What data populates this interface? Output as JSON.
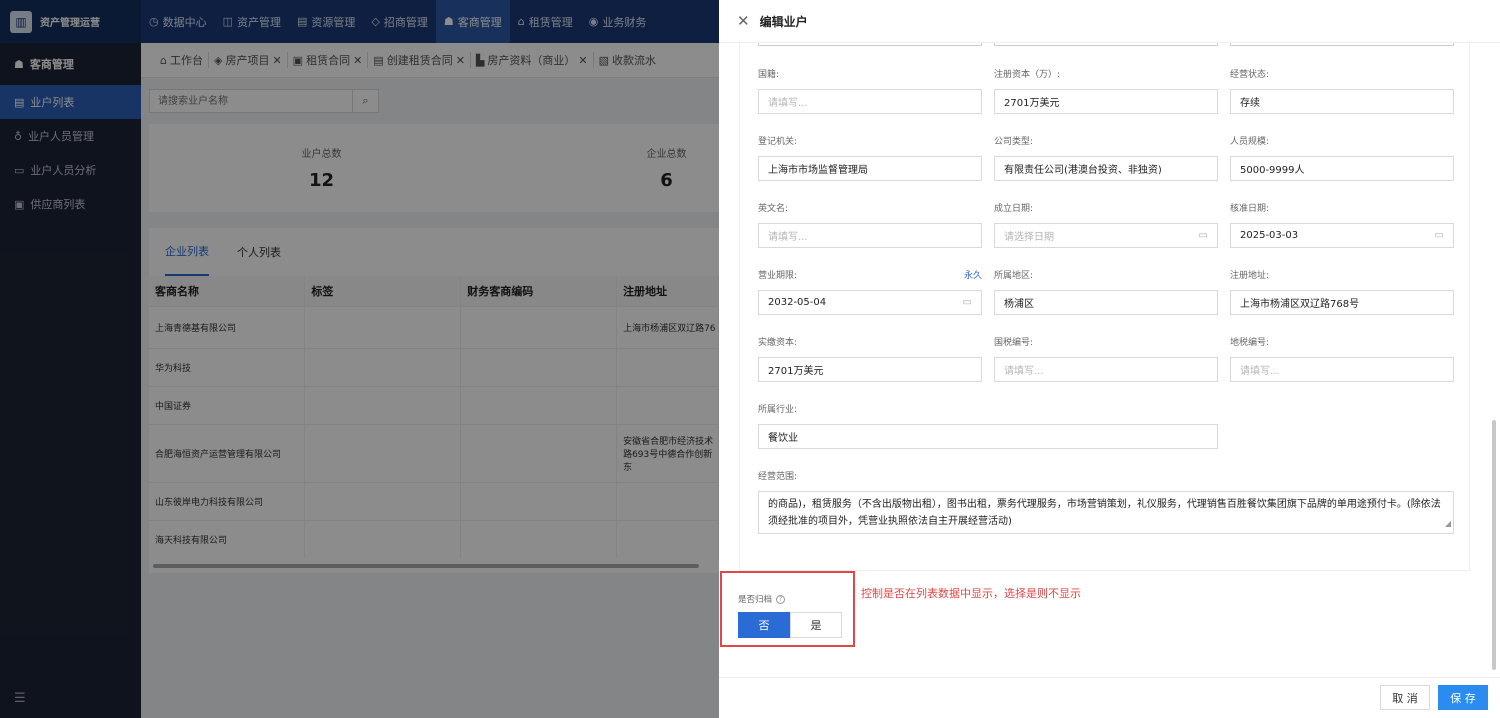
{
  "brand": {
    "name": "资产管理运营",
    "logo_icon": "building-icon"
  },
  "topnav": [
    {
      "label": "数据中心",
      "icon": "◷"
    },
    {
      "label": "资产管理",
      "icon": "◫"
    },
    {
      "label": "资源管理",
      "icon": "▤"
    },
    {
      "label": "招商管理",
      "icon": "◇"
    },
    {
      "label": "客商管理",
      "icon": "☗",
      "active": true
    },
    {
      "label": "租赁管理",
      "icon": "⌂"
    },
    {
      "label": "业务财务",
      "icon": "◉"
    }
  ],
  "sidebar": {
    "title": "客商管理",
    "items": [
      {
        "label": "业户列表",
        "icon": "▤",
        "active": true
      },
      {
        "label": "业户人员管理",
        "icon": "♁"
      },
      {
        "label": "业户人员分析",
        "icon": "▭"
      },
      {
        "label": "供应商列表",
        "icon": "▣"
      }
    ],
    "collapse_icon": "☰"
  },
  "tabs": [
    {
      "label": "工作台",
      "icon": "⌂",
      "closable": false
    },
    {
      "label": "房产项目",
      "icon": "◈",
      "closable": true
    },
    {
      "label": "租赁合同",
      "icon": "▣",
      "closable": true
    },
    {
      "label": "创建租赁合同",
      "icon": "▤",
      "closable": true
    },
    {
      "label": "房产资料（商业）",
      "icon": "▙",
      "closable": true
    },
    {
      "label": "收款流水",
      "icon": "▧",
      "closable": false
    }
  ],
  "search": {
    "placeholder": "请搜索业户名称"
  },
  "stats": [
    {
      "label": "业户总数",
      "value": "12"
    },
    {
      "label": "企业总数",
      "value": "6"
    }
  ],
  "list_tabs": [
    {
      "label": "企业列表",
      "active": true
    },
    {
      "label": "个人列表"
    }
  ],
  "table": {
    "headers": [
      "客商名称",
      "标签",
      "财务客商编码",
      "注册地址"
    ],
    "rows": [
      {
        "name": "上海青德基有限公司",
        "tag": "",
        "code": "",
        "addr": "上海市杨浦区双辽路76"
      },
      {
        "name": "华为科技",
        "tag": "",
        "code": "",
        "addr": ""
      },
      {
        "name": "中国证券",
        "tag": "",
        "code": "",
        "addr": ""
      },
      {
        "name": "合肥海恒资产运营管理有限公司",
        "tag": "",
        "code": "",
        "addr": "安徽省合肥市经济技术\n路693号中德合作创新\n东"
      },
      {
        "name": "山东彼岸电力科技有限公司",
        "tag": "",
        "code": "",
        "addr": ""
      },
      {
        "name": "海天科技有限公司",
        "tag": "",
        "code": "",
        "addr": ""
      }
    ]
  },
  "drawer": {
    "title": "编辑业户",
    "fields": {
      "nationality": {
        "label": "国籍:",
        "value": "",
        "placeholder": "请填写..."
      },
      "reg_capital": {
        "label": "注册资本（万）:",
        "value": "2701万美元"
      },
      "biz_status": {
        "label": "经营状态:",
        "value": "存续"
      },
      "authority": {
        "label": "登记机关:",
        "value": "上海市市场监督管理局"
      },
      "company_type": {
        "label": "公司类型:",
        "value": "有限责任公司(港澳台投资、非独资)"
      },
      "staff_size": {
        "label": "人员规模:",
        "value": "5000-9999人"
      },
      "english_name": {
        "label": "英文名:",
        "value": "",
        "placeholder": "请填写..."
      },
      "found_date": {
        "label": "成立日期:",
        "value": "",
        "placeholder": "请选择日期"
      },
      "approve_date": {
        "label": "核准日期:",
        "value": "2025-03-03"
      },
      "biz_term": {
        "label": "营业期限:",
        "link": "永久",
        "value": "2032-05-04"
      },
      "region": {
        "label": "所属地区:",
        "value": "杨浦区"
      },
      "reg_address": {
        "label": "注册地址:",
        "value": "上海市杨浦区双辽路768号"
      },
      "paid_capital": {
        "label": "实缴资本:",
        "value": "2701万美元"
      },
      "national_tax": {
        "label": "国税编号:",
        "value": "",
        "placeholder": "请填写..."
      },
      "local_tax": {
        "label": "地税编号:",
        "value": "",
        "placeholder": "请填写..."
      },
      "industry": {
        "label": "所属行业:",
        "value": "餐饮业"
      },
      "scope": {
        "label": "经营范围:",
        "value": "的商品)，租赁服务（不含出版物出租），图书出租，票务代理服务，市场营销策划，礼仪服务，代理销售百胜餐饮集团旗下品牌的单用途预付卡。(除依法须经批准的项目外，凭营业执照依法自主开展经营活动)"
      }
    },
    "archive": {
      "label": "是否归档",
      "options": [
        "否",
        "是"
      ],
      "selected": "否"
    },
    "note": "控制是否在列表数据中显示，选择是则不显示",
    "cancel": "取 消",
    "save": "保 存"
  },
  "colors": {
    "nav": "#1b3a78",
    "sidebar": "#1d2435",
    "accent": "#2b6bd6",
    "highlight": "#e04848"
  }
}
